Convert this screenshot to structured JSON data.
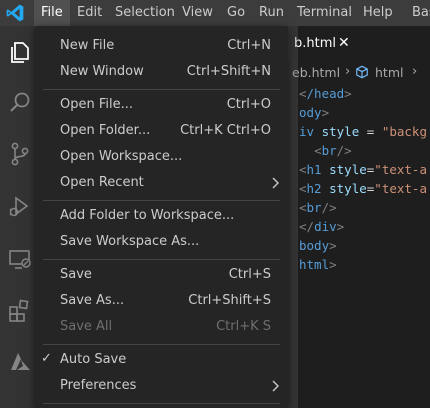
{
  "menubar": {
    "items": [
      "File",
      "Edit",
      "Selection",
      "View",
      "Go",
      "Run",
      "Terminal",
      "Help",
      "Bas"
    ],
    "active": "File"
  },
  "activity_bar": {
    "icons": [
      "explorer-icon",
      "search-icon",
      "source-control-icon",
      "run-debug-icon",
      "remote-explorer-icon",
      "extensions-icon",
      "azure-icon"
    ]
  },
  "editor": {
    "tab": {
      "label": "b.html",
      "close": "✕"
    },
    "breadcrumb": {
      "file": "eb.html",
      "separator": "›",
      "element": "html",
      "trailing": "›"
    },
    "code_lines": [
      {
        "segments": [
          [
            "bracket",
            "<"
          ],
          [
            "tag",
            "/head"
          ],
          [
            "bracket",
            ">"
          ]
        ]
      },
      {
        "segments": [
          [
            "tag",
            "ody"
          ],
          [
            "bracket",
            ">"
          ]
        ]
      },
      {
        "segments": [
          [
            "tag",
            "iv"
          ],
          [
            "plain",
            " "
          ],
          [
            "attr",
            "style"
          ],
          [
            "plain",
            " = "
          ],
          [
            "str",
            "\"backg"
          ]
        ]
      },
      {
        "segments": [
          [
            "plain",
            "  "
          ],
          [
            "bracket",
            "<"
          ],
          [
            "tag",
            "br"
          ],
          [
            "bracket",
            "/>"
          ]
        ]
      },
      {
        "segments": [
          [
            "bracket",
            "<"
          ],
          [
            "tag",
            "h1"
          ],
          [
            "plain",
            " "
          ],
          [
            "attr",
            "style"
          ],
          [
            "plain",
            "="
          ],
          [
            "str",
            "\"text-a"
          ]
        ]
      },
      {
        "segments": [
          [
            "bracket",
            "<"
          ],
          [
            "tag",
            "h2"
          ],
          [
            "plain",
            " "
          ],
          [
            "attr",
            "style"
          ],
          [
            "plain",
            "="
          ],
          [
            "str",
            "\"text-a"
          ]
        ]
      },
      {
        "segments": [
          [
            "bracket",
            "<"
          ],
          [
            "tag",
            "br"
          ],
          [
            "bracket",
            "/>"
          ]
        ]
      },
      {
        "segments": [
          [
            "bracket",
            "</"
          ],
          [
            "tag",
            "div"
          ],
          [
            "bracket",
            ">"
          ]
        ]
      },
      {
        "segments": [
          [
            "tag",
            "body"
          ],
          [
            "bracket",
            ">"
          ]
        ]
      },
      {
        "segments": [
          [
            "tag",
            "html"
          ],
          [
            "bracket",
            ">"
          ]
        ]
      }
    ]
  },
  "file_menu": {
    "items": [
      {
        "label": "New File",
        "shortcut": "Ctrl+N"
      },
      {
        "label": "New Window",
        "shortcut": "Ctrl+Shift+N"
      },
      {
        "separator": true
      },
      {
        "label": "Open File...",
        "shortcut": "Ctrl+O"
      },
      {
        "label": "Open Folder...",
        "shortcut": "Ctrl+K Ctrl+O"
      },
      {
        "label": "Open Workspace...",
        "shortcut": ""
      },
      {
        "label": "Open Recent",
        "shortcut": "",
        "submenu": true
      },
      {
        "separator": true
      },
      {
        "label": "Add Folder to Workspace...",
        "shortcut": ""
      },
      {
        "label": "Save Workspace As...",
        "shortcut": ""
      },
      {
        "separator": true
      },
      {
        "label": "Save",
        "shortcut": "Ctrl+S"
      },
      {
        "label": "Save As...",
        "shortcut": "Ctrl+Shift+S"
      },
      {
        "label": "Save All",
        "shortcut": "Ctrl+K S",
        "disabled": true
      },
      {
        "separator": true
      },
      {
        "label": "Auto Save",
        "shortcut": "",
        "checked": true
      },
      {
        "label": "Preferences",
        "shortcut": "",
        "submenu": true
      },
      {
        "separator": true
      }
    ]
  },
  "colors": {
    "menubar_bg": "#3c3c3c",
    "menu_bg": "#252526",
    "editor_bg": "#1e1e1e",
    "activity_bar_bg": "#333333",
    "vscode_blue": "#0078d4"
  }
}
